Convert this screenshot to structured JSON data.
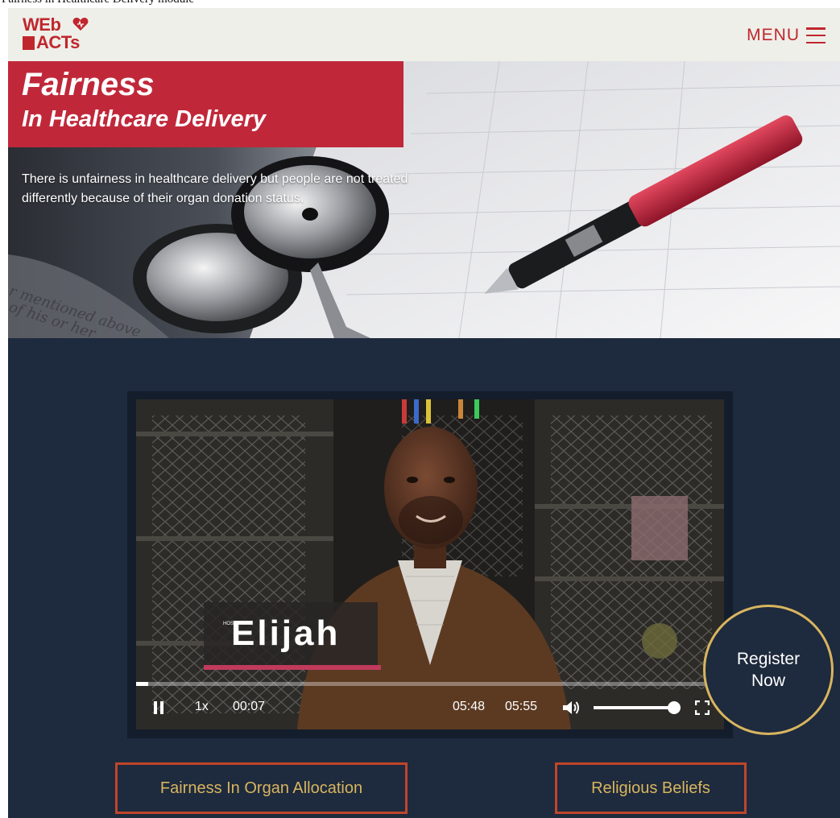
{
  "page_caption": "Fairness in Healthcare Delivery module",
  "header": {
    "logo": {
      "line1": "WEb",
      "line2": "ACTs"
    },
    "menu_label": "MENU"
  },
  "hero": {
    "title": "Fairness",
    "subtitle": "In Healthcare Delivery",
    "description": "There is unfairness in healthcare delivery but people are not treated differently because of their organ donation status."
  },
  "video": {
    "host_tag": "HOST",
    "host_name": "Elijah",
    "playback_speed": "1x",
    "current_time": "00:07",
    "remaining_time": "05:48",
    "duration": "05:55",
    "progress_fraction": 0.02,
    "volume_fraction": 1.0
  },
  "register_button": {
    "label": "Register Now"
  },
  "nav_buttons": {
    "organ_allocation": "Fairness In Organ Allocation",
    "religious_beliefs": "Religious Beliefs"
  },
  "colors": {
    "brand_red": "#c0283a",
    "navy": "#1e2a3d",
    "gold": "#d8b55f",
    "button_border": "#c0452a",
    "header_bg": "#eeefe9"
  },
  "icons": [
    "heart-icon",
    "hamburger-icon",
    "pause-icon",
    "volume-icon",
    "fullscreen-icon"
  ]
}
